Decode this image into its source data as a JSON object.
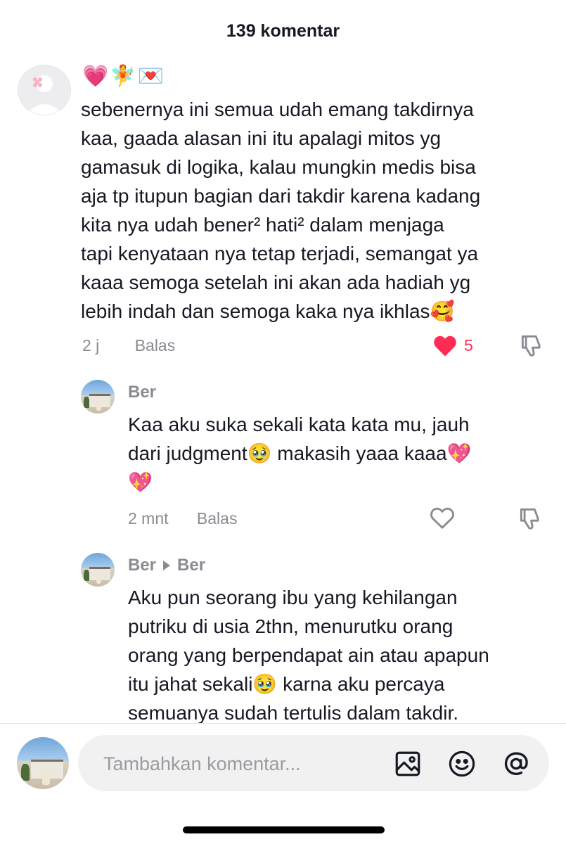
{
  "header": {
    "title": "139 komentar"
  },
  "comments": [
    {
      "username_emojis": "💗🧚💌",
      "text_lines": [
        "sebenernya ini semua udah emang takdirnya",
        "kaa, gaada alasan ini itu apalagi mitos yg",
        "gamasuk di logika, kalau mungkin medis bisa",
        "aja tp itupun bagian dari takdir karena kadang",
        "kita nya udah bener² hati² dalam menjaga",
        "tapi kenyataan nya tetap terjadi, semangat ya",
        "kaaa semoga setelah ini akan ada hadiah yg",
        "lebih indah dan semoga kaka nya ikhlas🥰"
      ],
      "time": "2 j",
      "reply_label": "Balas",
      "like_count": "5",
      "liked": true
    },
    {
      "username": "Ber",
      "text_lines": [
        "Kaa aku suka sekali kata kata mu, jauh",
        "dari judgment🥹 makasih yaaa kaaa💖",
        "💖"
      ],
      "time": "2 mnt",
      "reply_label": "Balas",
      "liked": false
    },
    {
      "username": "Ber",
      "reply_to": "Ber",
      "text_lines": [
        "Aku pun seorang ibu yang kehilangan",
        "putriku di usia 2thn, menurutku orang",
        "orang yang berpendapat ain atau apapun",
        "itu jahat sekali🥹 karna aku percaya",
        "semuanya sudah tertulis dalam takdir."
      ]
    }
  ],
  "input": {
    "placeholder": "Tambahkan komentar..."
  },
  "icons": {
    "like_filled": "heart-filled-icon",
    "like_outline": "heart-outline-icon",
    "dislike": "thumbs-down-icon",
    "image": "image-icon",
    "emoji": "smiley-icon",
    "mention": "at-icon"
  },
  "colors": {
    "like": "#fe2c55",
    "muted": "#8a8b91",
    "text": "#161823"
  }
}
